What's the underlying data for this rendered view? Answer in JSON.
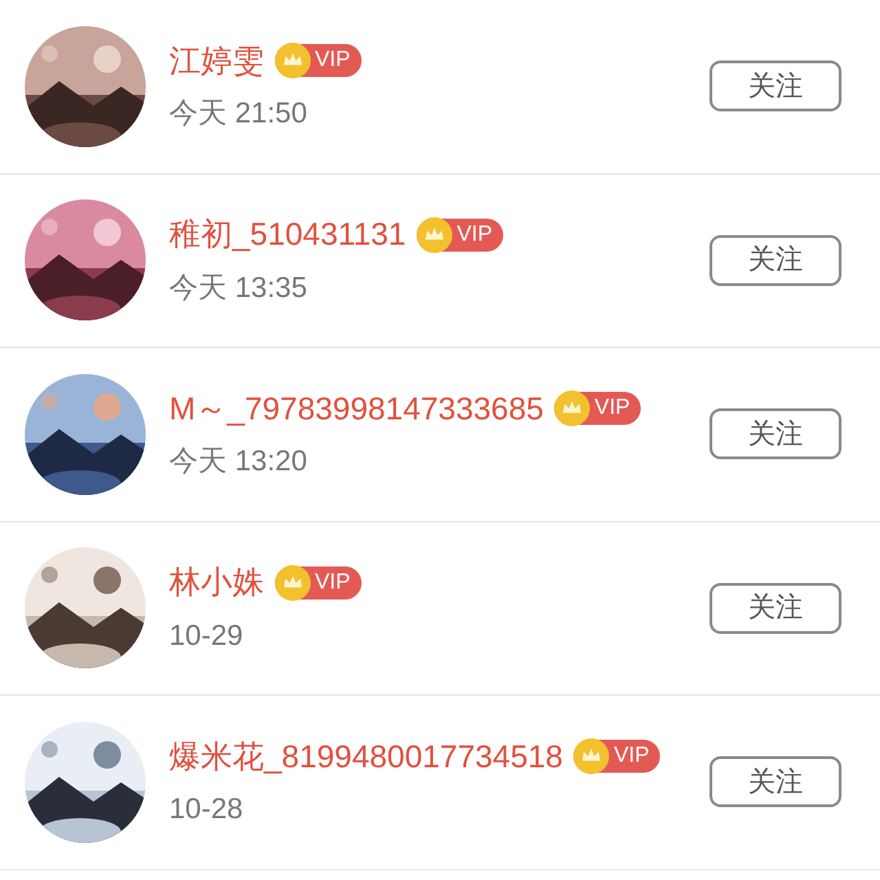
{
  "users": [
    {
      "name": "江婷雯",
      "badge": "VIP",
      "time": "今天 21:50",
      "button": "关注"
    },
    {
      "name": "稚初_510431131",
      "badge": "VIP",
      "time": "今天 13:35",
      "button": "关注"
    },
    {
      "name": "M～_79783998147333685",
      "badge": "VIP",
      "time": "今天 13:20",
      "button": "关注"
    },
    {
      "name": "林小姝",
      "badge": "VIP",
      "time": "10-29",
      "button": "关注"
    },
    {
      "name": "爆米花_8199480017734518",
      "badge": "VIP",
      "time": "10-28",
      "button": "关注"
    }
  ]
}
